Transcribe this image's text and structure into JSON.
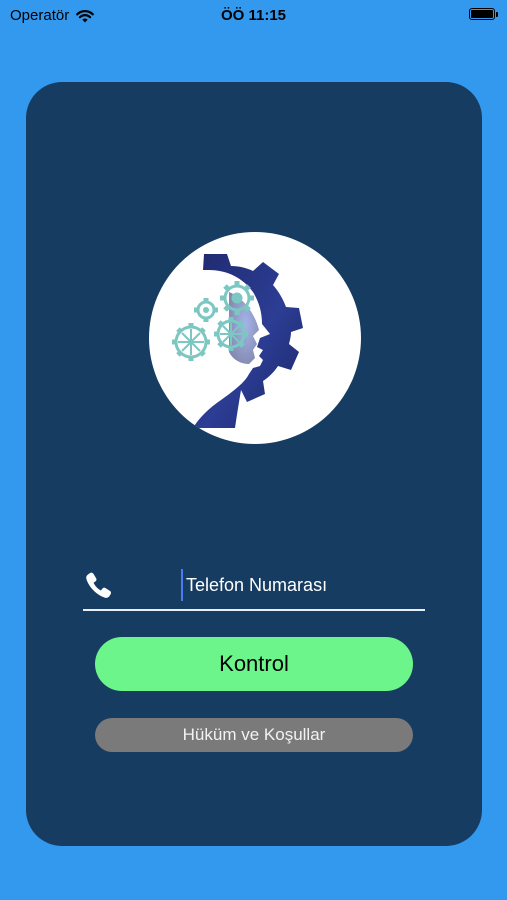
{
  "status_bar": {
    "carrier": "Operatör",
    "time": "ÖÖ 11:15",
    "wifi_icon": "wifi-icon",
    "battery_icon": "battery-icon",
    "battery_level": 1.0
  },
  "login": {
    "logo_icon": "brain-gears-head-logo",
    "phone_icon": "phone-icon",
    "phone_input": {
      "placeholder": "Telefon Numarası",
      "value": ""
    },
    "submit_label": "Kontrol",
    "terms_label": "Hüküm ve Koşullar"
  },
  "colors": {
    "background": "#3399ee",
    "card": "#163c61",
    "primary_button": "#6cf58a",
    "secondary_button": "#7a7a7a",
    "logo_navy": "#24307a",
    "gear_teal": "#7cc7c2"
  }
}
